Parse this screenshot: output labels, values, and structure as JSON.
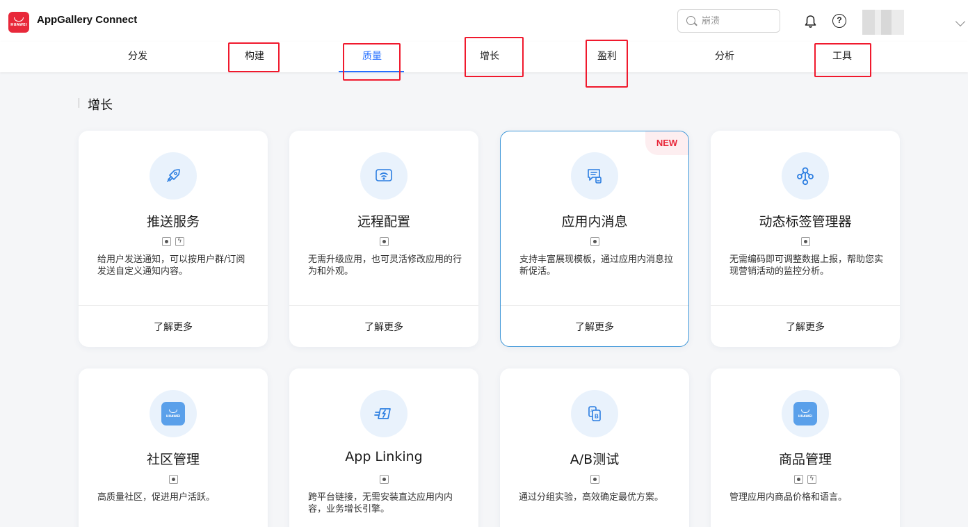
{
  "header": {
    "brand": "AppGallery Connect",
    "logo_text": "HUAWEI",
    "search_placeholder": "崩溃"
  },
  "nav": {
    "tabs": [
      {
        "label": "分发",
        "active": false
      },
      {
        "label": "构建",
        "active": false
      },
      {
        "label": "质量",
        "active": true
      },
      {
        "label": "增长",
        "active": false
      },
      {
        "label": "盈利",
        "active": false
      },
      {
        "label": "分析",
        "active": false
      },
      {
        "label": "工具",
        "active": false
      }
    ]
  },
  "section": {
    "title": "增长"
  },
  "cards": [
    {
      "title": "推送服务",
      "icon": "rocket-icon",
      "platforms": [
        "android",
        "quickapp"
      ],
      "desc": "给用户发送通知，可以按用户群/订阅发送自定义通知内容。",
      "more": "了解更多"
    },
    {
      "title": "远程配置",
      "icon": "remote-config-icon",
      "platforms": [
        "android"
      ],
      "desc": "无需升级应用，也可灵活修改应用的行为和外观。",
      "more": "了解更多"
    },
    {
      "title": "应用内消息",
      "icon": "message-icon",
      "platforms": [
        "android"
      ],
      "desc": "支持丰富展现模板，通过应用内消息拉新促活。",
      "more": "了解更多",
      "badge": "NEW"
    },
    {
      "title": "动态标签管理器",
      "icon": "tag-network-icon",
      "platforms": [
        "android"
      ],
      "desc": "无需编码即可调整数据上报，帮助您实现营销活动的监控分析。",
      "more": "了解更多"
    },
    {
      "title": "社区管理",
      "icon": "huawei-icon",
      "platforms": [
        "android"
      ],
      "desc": "高质量社区，促进用户活跃。",
      "more": "",
      "icon_text": "HUAWEI"
    },
    {
      "title": "App Linking",
      "icon": "app-linking-icon",
      "platforms": [
        "android"
      ],
      "desc": "跨平台链接，无需安装直达应用内内容，业务增长引擎。",
      "more": ""
    },
    {
      "title": "A/B测试",
      "icon": "ab-test-icon",
      "platforms": [
        "android"
      ],
      "desc": "通过分组实验，高效确定最优方案。",
      "more": ""
    },
    {
      "title": "商品管理",
      "icon": "huawei-icon",
      "platforms": [
        "android",
        "quickapp"
      ],
      "desc": "管理应用内商品价格和语言。",
      "more": "",
      "icon_text": "HUAWEI"
    }
  ],
  "colors": {
    "accent": "#256fff",
    "annotation": "#f0192d",
    "brand": "#e8283a",
    "icon_blue": "#2a7de1"
  }
}
